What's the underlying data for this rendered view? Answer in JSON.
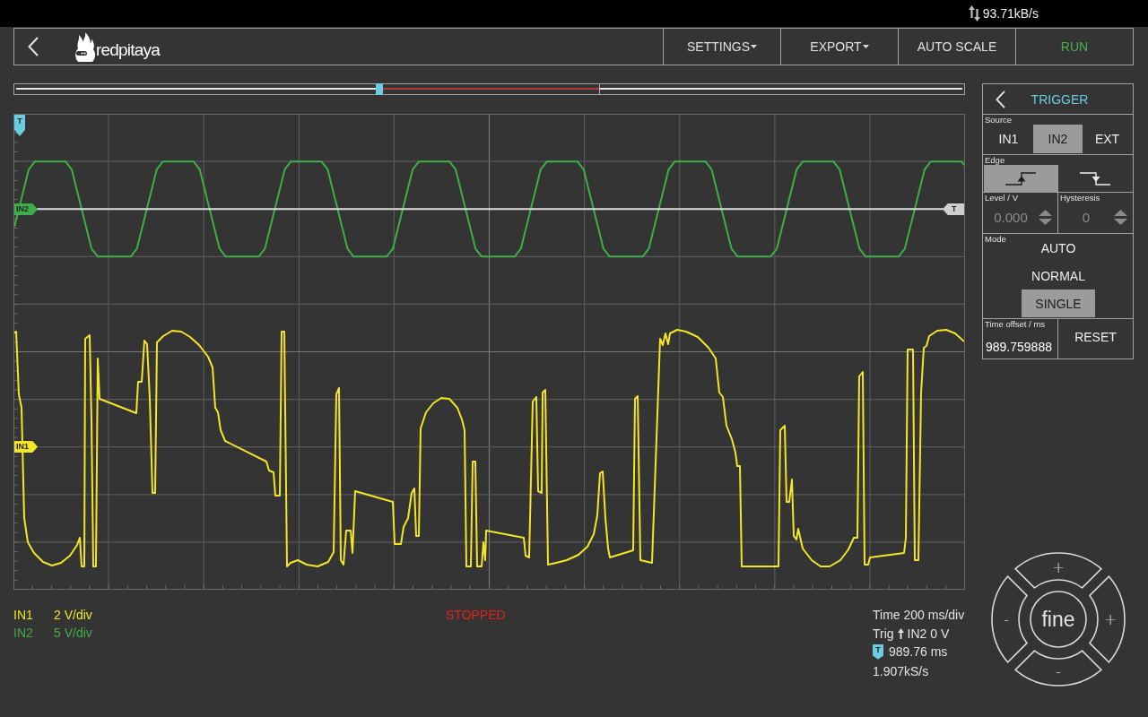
{
  "status_bar": {
    "data_rate": "93.71kB/s"
  },
  "header": {
    "logo_text": "redpitaya",
    "buttons": [
      {
        "label": "SETTINGS",
        "kind": "settings_menu"
      },
      {
        "label": "EXPORT",
        "kind": "export_menu"
      },
      {
        "label": "AUTO SCALE",
        "kind": "auto_scale"
      },
      {
        "label": "RUN",
        "kind": "run"
      }
    ]
  },
  "plot": {
    "markers": [
      {
        "kind": "time",
        "label": "T",
        "color": "#6ccbe0"
      },
      {
        "kind": "channel",
        "label": "IN2",
        "color": "#3fae49"
      },
      {
        "kind": "level",
        "label": "T",
        "color": "#cfcfcf"
      },
      {
        "kind": "channel",
        "label": "IN1",
        "color": "#f4e526"
      }
    ]
  },
  "channels": [
    {
      "name": "IN1",
      "scale": "2 V/div",
      "color": "#f4e526"
    },
    {
      "name": "IN2",
      "scale": "5 V/div",
      "color": "#3fae49"
    }
  ],
  "run_state": "STOPPED",
  "acquisition": {
    "time_scale": "Time 200 ms/div",
    "trigger_label": "Trig",
    "trigger_source": "IN2 0 V",
    "offset_marker": "T",
    "offset": "989.76 ms",
    "sample_rate": "1.907kS/s"
  },
  "trigger": {
    "title": "TRIGGER",
    "source": {
      "label": "Source",
      "options": [
        {
          "label": "IN1",
          "selected": false
        },
        {
          "label": "IN2",
          "selected": true
        },
        {
          "label": "EXT",
          "selected": false
        }
      ]
    },
    "edge": {
      "label": "Edge",
      "options": [
        {
          "kind": "rising",
          "selected": true
        },
        {
          "kind": "falling",
          "selected": false
        }
      ]
    },
    "trigger_level": {
      "label": "Level / V",
      "value": "0.000",
      "disabled": true
    },
    "hysteresis": {
      "label": "Hysteresis",
      "value": "0",
      "disabled": true
    },
    "mode": {
      "label": "Mode",
      "options": [
        {
          "label": "AUTO",
          "selected": false
        },
        {
          "label": "NORMAL",
          "selected": false
        },
        {
          "label": "SINGLE",
          "selected": true
        }
      ]
    },
    "time_offset": {
      "label": "Time offset / ms",
      "value": "989.759888"
    },
    "reset": "RESET"
  },
  "dial": {
    "center": "fine",
    "segments": [
      {
        "kind": "top",
        "symbol": "+"
      },
      {
        "kind": "right",
        "symbol": "+"
      },
      {
        "kind": "bottom",
        "symbol": "-"
      },
      {
        "kind": "left",
        "symbol": "-"
      }
    ]
  }
}
